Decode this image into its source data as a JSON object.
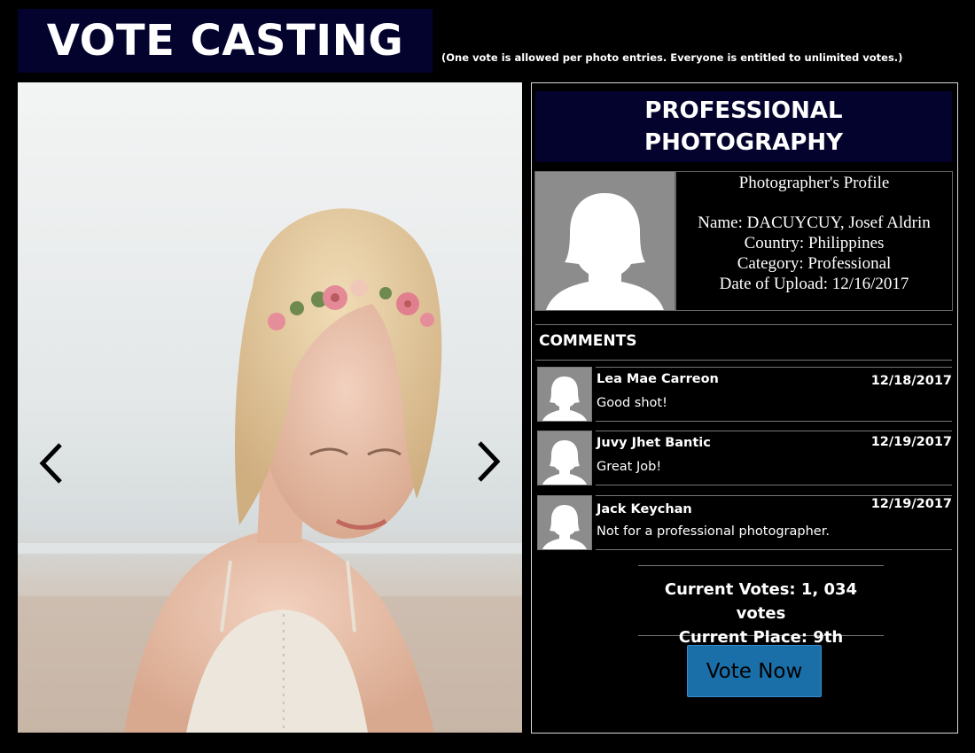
{
  "header": {
    "title": "VOTE CASTING",
    "note": "(One vote is allowed per photo entries. Everyone is entitled to unlimited votes.)"
  },
  "gallery": {
    "prev_icon": "chevron-left-icon",
    "next_icon": "chevron-right-icon"
  },
  "category": {
    "title": "PROFESSIONAL PHOTOGRAPHY"
  },
  "profile": {
    "heading": "Photographer's Profile",
    "name": "Name: DACUYCUY, Josef Aldrin",
    "country": "Country: Philippines",
    "category": "Category: Professional",
    "upload_date": "Date of Upload: 12/16/2017",
    "avatar_icon": "person-placeholder-icon"
  },
  "comments": {
    "title": "COMMENTS",
    "items": [
      {
        "name": "Lea Mae Carreon",
        "date": "12/18/2017",
        "text": "Good shot!"
      },
      {
        "name": "Juvy Jhet Bantic",
        "date": "12/19/2017",
        "text": "Great Job!"
      },
      {
        "name": "Jack Keychan",
        "date": "12/19/2017",
        "text": "Not for a professional photographer."
      }
    ]
  },
  "stats": {
    "votes": "Current Votes: 1, 034 votes",
    "place": "Current Place: 9th"
  },
  "vote_button": {
    "label": "Vote Now"
  },
  "colors": {
    "background": "#000000",
    "header_bg": "#03032e",
    "button_bg": "#1a6fa8",
    "avatar_bg": "#8c8c8c"
  }
}
